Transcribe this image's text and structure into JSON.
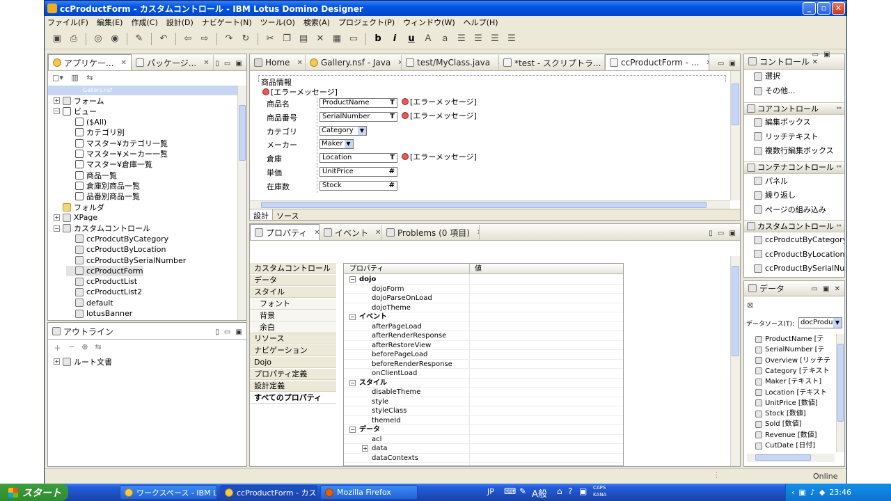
{
  "window": {
    "title": "ccProductForm - カスタムコントロール - IBM Lotus Domino Designer",
    "min": "_",
    "max": "▫",
    "close": "✕"
  },
  "menu": [
    "ファイル(F)",
    "編集(E)",
    "作成(C)",
    "設計(D)",
    "ナビゲート(N)",
    "ツール(O)",
    "検索(A)",
    "プロジェクト(P)",
    "ウィンドウ(W)",
    "ヘルプ(H)"
  ],
  "toolbar_text_buttons": {
    "bold": "b",
    "italic": "i",
    "underline": "u"
  },
  "left_pane": {
    "tabs": [
      {
        "label": "アプリケー..."
      },
      {
        "label": "パッケージ..."
      }
    ],
    "selected_db": "Gallery.nsf",
    "tree": [
      {
        "label": "フォーム",
        "level": 0,
        "exp": "+",
        "icon": "form"
      },
      {
        "label": "ビュー",
        "level": 0,
        "exp": "−",
        "icon": "view"
      },
      {
        "label": "($All)",
        "level": 1,
        "icon": "view"
      },
      {
        "label": "カテゴリ別",
        "level": 1,
        "icon": "view"
      },
      {
        "label": "マスター¥カテゴリ一覧",
        "level": 1,
        "icon": "view"
      },
      {
        "label": "マスター¥メーカー一覧",
        "level": 1,
        "icon": "view"
      },
      {
        "label": "マスター¥倉庫一覧",
        "level": 1,
        "icon": "view"
      },
      {
        "label": "商品一覧",
        "level": 1,
        "icon": "view"
      },
      {
        "label": "倉庫別商品一覧",
        "level": 1,
        "icon": "view"
      },
      {
        "label": "品番別商品一覧",
        "level": 1,
        "icon": "view"
      },
      {
        "label": "フォルダ",
        "level": 0,
        "icon": "folder"
      },
      {
        "label": "XPage",
        "level": 0,
        "exp": "+",
        "icon": "xpage"
      },
      {
        "label": "カスタムコントロール",
        "level": 0,
        "exp": "−",
        "icon": "cc"
      },
      {
        "label": "ccProdcutByCategory",
        "level": 1,
        "icon": "cc"
      },
      {
        "label": "ccProductByLocation",
        "level": 1,
        "icon": "cc"
      },
      {
        "label": "ccProductBySerialNumber",
        "level": 1,
        "icon": "cc"
      },
      {
        "label": "ccProductForm",
        "level": 1,
        "icon": "cc",
        "selected": true
      },
      {
        "label": "ccProductList",
        "level": 1,
        "icon": "cc"
      },
      {
        "label": "ccProductList2",
        "level": 1,
        "icon": "cc"
      },
      {
        "label": "default",
        "level": 1,
        "icon": "cc"
      },
      {
        "label": "lotusBanner",
        "level": 1,
        "icon": "cc"
      }
    ]
  },
  "outline": {
    "title": "アウトライン",
    "root": "ルート文書"
  },
  "editor": {
    "tabs": [
      {
        "label": "Home"
      },
      {
        "label": "Gallery.nsf - Java"
      },
      {
        "label": "test/MyClass.java"
      },
      {
        "label": "*test - スクリプトラ..."
      },
      {
        "label": "ccProductForm - ...",
        "active": true
      }
    ],
    "form_header": "商品情報",
    "error_label": "[エラーメッセージ]",
    "rows": [
      {
        "label": "商品名",
        "field": "ProductName",
        "kind": "T",
        "err": "[エラーメッセージ]"
      },
      {
        "label": "商品番号",
        "field": "SerialNumber",
        "kind": "T",
        "err": "[エラーメッセージ]"
      },
      {
        "label": "カテゴリ",
        "field": "Category",
        "kind": "dd"
      },
      {
        "label": "メーカー",
        "field": "Maker",
        "kind": "dd"
      },
      {
        "label": "倉庫",
        "field": "Location",
        "kind": "T",
        "err": "[エラーメッセージ]"
      },
      {
        "label": "単価",
        "field": "UnitPrice",
        "kind": "#"
      },
      {
        "label": "在庫数",
        "field": "Stock",
        "kind": "#"
      }
    ],
    "bottom_tabs": [
      "設計",
      "ソース"
    ]
  },
  "props_pane": {
    "tabs": [
      {
        "label": "プロパティ"
      },
      {
        "label": "イベント"
      },
      {
        "label": "Problems (0 項目)"
      }
    ],
    "categories": [
      {
        "label": "カスタムコントロール"
      },
      {
        "label": "データ"
      },
      {
        "label": "スタイル"
      },
      {
        "label": "フォント",
        "sub": true
      },
      {
        "label": "背景",
        "sub": true
      },
      {
        "label": "余白",
        "sub": true
      },
      {
        "label": "リソース"
      },
      {
        "label": "ナビゲーション"
      },
      {
        "label": "Dojo"
      },
      {
        "label": "プロパティ定義"
      },
      {
        "label": "設計定義"
      },
      {
        "label": "すべてのプロパティ",
        "selected": true
      }
    ],
    "table_headers": {
      "prop": "プロパティ",
      "value": "値"
    },
    "rows": [
      {
        "label": "dojo",
        "group": true
      },
      {
        "label": "dojoForm"
      },
      {
        "label": "dojoParseOnLoad"
      },
      {
        "label": "dojoTheme"
      },
      {
        "label": "イベント",
        "group": true
      },
      {
        "label": "afterPageLoad"
      },
      {
        "label": "afterRenderResponse"
      },
      {
        "label": "afterRestoreView"
      },
      {
        "label": "beforePageLoad"
      },
      {
        "label": "beforeRenderResponse"
      },
      {
        "label": "onClientLoad"
      },
      {
        "label": "スタイル",
        "group": true
      },
      {
        "label": "disableTheme"
      },
      {
        "label": "style"
      },
      {
        "label": "styleClass"
      },
      {
        "label": "themeId"
      },
      {
        "label": "データ",
        "group": true
      },
      {
        "label": "acl"
      },
      {
        "label": "data",
        "expandable": true
      },
      {
        "label": "dataContexts"
      }
    ]
  },
  "palette": {
    "title": "コントロール",
    "top_items": [
      "選択",
      "その他..."
    ],
    "sections": [
      {
        "title": "コアコントロール",
        "items": [
          "編集ボックス",
          "リッチテキスト",
          "複数行編集ボックス"
        ]
      },
      {
        "title": "コンテナコントロール",
        "items": [
          "パネル",
          "繰り返し",
          "ページの組み込み"
        ]
      },
      {
        "title": "カスタムコントロール",
        "items": [
          "ccProdcutByCategory",
          "ccProductByLocation",
          "ccProductBySerialNum..."
        ]
      }
    ]
  },
  "data_pane": {
    "title": "データ",
    "source_label": "データソース(T):",
    "source_value": "docProdu",
    "items": [
      "ProductName [テ",
      "SerialNumber [テ",
      "Overview [リッチテ",
      "Category [テキスト",
      "Maker [テキスト]",
      "Location [テキスト",
      "UnitPrice [数値]",
      "Stock [数値]",
      "Sold [数値]",
      "Revenue [数値]",
      "CutDate [日付]"
    ]
  },
  "status": {
    "online": "Online"
  },
  "taskbar": {
    "start": "スタート",
    "tasks": [
      "ワークスペース - IBM L...",
      "ccProductForm - カス...",
      "Mozilla Firefox"
    ],
    "lang": "JP",
    "ime": "A般",
    "clock": "23:46",
    "caps": "CAPS",
    "kana": "KANA"
  }
}
